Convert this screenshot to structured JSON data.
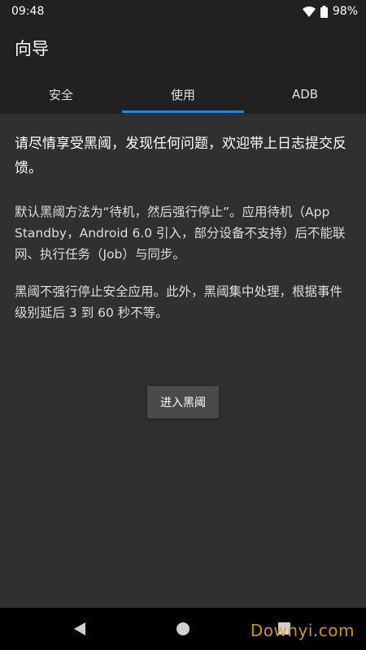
{
  "status_bar": {
    "time": "09:48",
    "battery": "98%",
    "icons": [
      "wifi-icon",
      "battery-icon"
    ]
  },
  "app_bar": {
    "title": "向导"
  },
  "tabs": [
    {
      "label": "安全",
      "active": false
    },
    {
      "label": "使用",
      "active": true
    },
    {
      "label": "ADB",
      "active": false
    }
  ],
  "content": {
    "lead": "请尽情享受黑阈，发现任何问题，欢迎带上日志提交反馈。",
    "paragraph_2": "默认黑阈方法为“待机，然后强行停止”。应用待机（App Standby，Android 6.0 引入，部分设备不支持）后不能联网、执行任务（Job）与同步。",
    "paragraph_3": "黑阈不强行停止安全应用。此外，黑阈集中处理，根据事件级别延后 3 到 60 秒不等。"
  },
  "button": {
    "label": "进入黑阈"
  },
  "nav_bar": {
    "icons": [
      "back-icon",
      "home-icon",
      "recents-icon"
    ]
  },
  "watermark": "Downyi.com",
  "colors": {
    "background": "#303030",
    "app_bar": "#212121",
    "tab_indicator": "#1e88e5",
    "button": "#4a4a4a"
  }
}
